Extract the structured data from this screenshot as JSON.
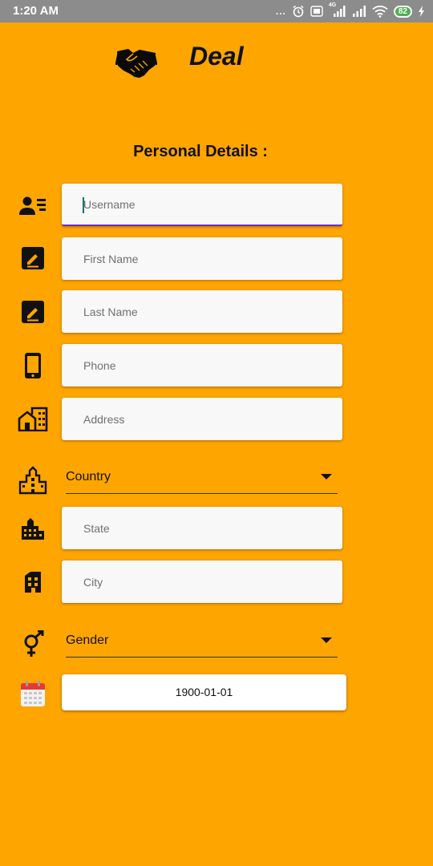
{
  "status_bar": {
    "time": "1:20 AM",
    "more_indicator": "...",
    "network_label": "4G",
    "battery_level": "82",
    "icons": [
      "more-dots-icon",
      "alarm-icon",
      "volte-icon",
      "signal-icon",
      "signal-icon",
      "wifi-icon",
      "battery-icon",
      "charging-icon"
    ]
  },
  "header": {
    "logo_icon": "handshake-icon",
    "title": "Deal"
  },
  "form": {
    "title": "Personal Details :",
    "fields": {
      "username": {
        "placeholder": "Username",
        "icon": "contact-card-icon"
      },
      "first_name": {
        "placeholder": "First Name",
        "icon": "edit-icon"
      },
      "last_name": {
        "placeholder": "Last Name",
        "icon": "edit-icon"
      },
      "phone": {
        "placeholder": "Phone",
        "icon": "smartphone-icon"
      },
      "address": {
        "placeholder": "Address",
        "icon": "home-building-icon"
      },
      "country": {
        "selected": "Country",
        "icon": "city-icon"
      },
      "state": {
        "placeholder": "State",
        "icon": "buildings-icon"
      },
      "city": {
        "placeholder": "City",
        "icon": "office-building-icon"
      },
      "gender": {
        "selected": "Gender",
        "icon": "gender-icon"
      },
      "dob": {
        "value": "1900-01-01",
        "icon": "calendar-icon"
      }
    }
  },
  "colors": {
    "background": "#FFA500",
    "status_bar": "#8C8C8C",
    "field_background": "#F8F8F8",
    "active_underline": "#6A2BC8",
    "cursor": "#00796B",
    "battery": "#4CAF50",
    "calendar_accent": "#E53935"
  }
}
